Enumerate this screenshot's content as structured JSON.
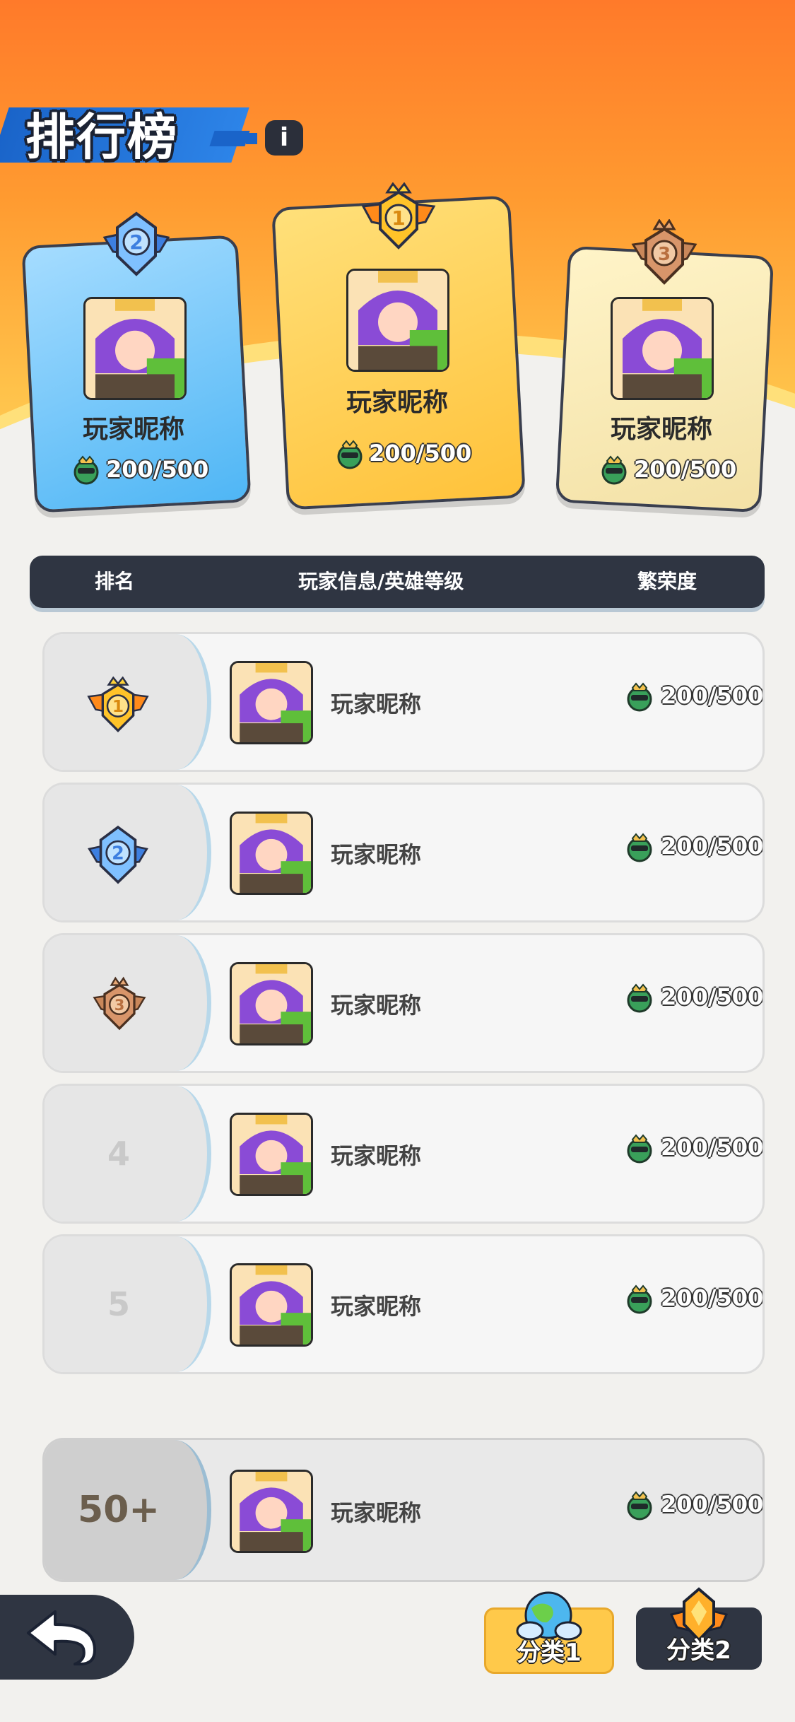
{
  "header": {
    "title": "排行榜",
    "info_icon": "i"
  },
  "podium": [
    {
      "rank": "2",
      "name": "玩家昵称",
      "score": "200/500",
      "medal_color": "#4a8ee8"
    },
    {
      "rank": "1",
      "name": "玩家昵称",
      "score": "200/500",
      "medal_color": "#ffb320"
    },
    {
      "rank": "3",
      "name": "玩家昵称",
      "score": "200/500",
      "medal_color": "#c9875a"
    }
  ],
  "table": {
    "headers": [
      "排名",
      "玩家信息/英雄等级",
      "繁荣度"
    ],
    "rows": [
      {
        "rank": "1",
        "name": "玩家昵称",
        "score": "200/500"
      },
      {
        "rank": "2",
        "name": "玩家昵称",
        "score": "200/500"
      },
      {
        "rank": "3",
        "name": "玩家昵称",
        "score": "200/500"
      },
      {
        "rank": "4",
        "name": "玩家昵称",
        "score": "200/500"
      },
      {
        "rank": "5",
        "name": "玩家昵称",
        "score": "200/500"
      }
    ],
    "self_row": {
      "rank": "50+",
      "name": "玩家昵称",
      "score": "200/500"
    }
  },
  "tabs": [
    {
      "label": "分类1"
    },
    {
      "label": "分类2"
    }
  ],
  "icons": {
    "back": "back-arrow-icon",
    "coin": "prosperity-coin-icon"
  }
}
